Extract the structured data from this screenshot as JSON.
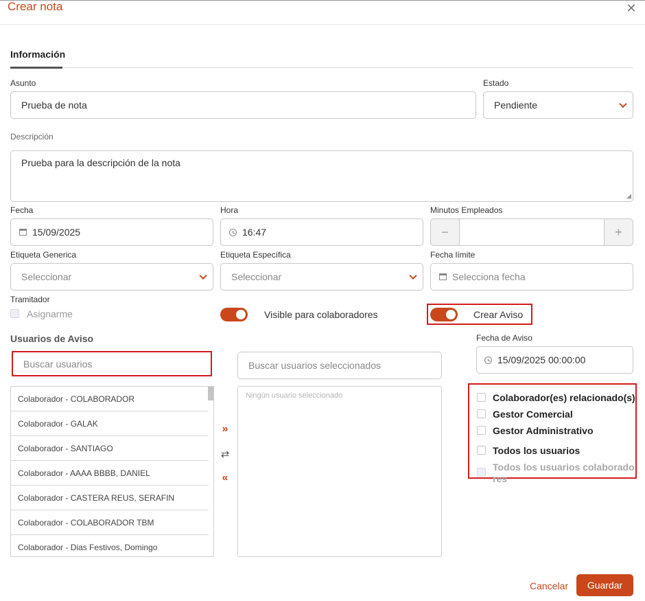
{
  "dialog": {
    "title": "Crear nota",
    "close_icon": "close-icon"
  },
  "tabs": [
    {
      "label": "Información",
      "active": true
    }
  ],
  "form": {
    "asunto": {
      "label": "Asunto",
      "value": "Prueba de nota"
    },
    "estado": {
      "label": "Estado",
      "value": "Pendiente"
    },
    "descripcion": {
      "label": "Descripción",
      "value": "Prueba para la descripción de la nota"
    },
    "fecha": {
      "label": "Fecha",
      "value": "15/09/2025"
    },
    "hora": {
      "label": "Hora",
      "value": "16:47"
    },
    "minutos": {
      "label": "Minutos Empleados",
      "value": "",
      "minus": "−",
      "plus": "+"
    },
    "etiqueta_generica": {
      "label": "Etiqueta Generica",
      "placeholder": "Seleccionar"
    },
    "etiqueta_especifica": {
      "label": "Etiqueta Específica",
      "placeholder": "Seleccionar"
    },
    "fecha_limite": {
      "label": "Fecha límite",
      "placeholder": "Selecciona fecha"
    },
    "tramitador": {
      "label": "Tramitador",
      "asignarme": "Asignarme"
    },
    "visible_colaboradores": {
      "label": "Visible para colaboradores",
      "on": true
    },
    "crear_aviso": {
      "label": "Crear Aviso",
      "on": true
    }
  },
  "aviso": {
    "title": "Usuarios de Aviso",
    "search_placeholder": "Buscar usuarios",
    "selected_search_placeholder": "Buscar usuarios seleccionados",
    "empty_selected": "Ningún usuario seleccionado",
    "users": [
      "Colaborador - COLABORADOR",
      "Colaborador - GALAK",
      "Colaborador - SANTIAGO",
      "Colaborador - AAAA BBBB, DANIEL",
      "Colaborador - CASTERA REUS, SERAFIN",
      "Colaborador - COLABORADOR TBM",
      "Colaborador - Dias Festivos, Domingo"
    ],
    "move_right": "»",
    "swap": "⇄",
    "move_left": "«",
    "fecha_aviso": {
      "label": "Fecha de Aviso",
      "value": "15/09/2025 00:00:00"
    },
    "options": [
      {
        "label": "Colaborador(es) relacionado(s)",
        "disabled": false
      },
      {
        "label": "Gestor Comercial",
        "disabled": false
      },
      {
        "label": "Gestor Administrativo",
        "disabled": false
      },
      {
        "label": "Todos los usuarios",
        "disabled": false
      },
      {
        "label": "Todos los usuarios colaboradores",
        "disabled": true
      }
    ]
  },
  "footer": {
    "cancel": "Cancelar",
    "save": "Guardar"
  },
  "colors": {
    "accent": "#c9471a",
    "highlight": "#d21c1c"
  }
}
